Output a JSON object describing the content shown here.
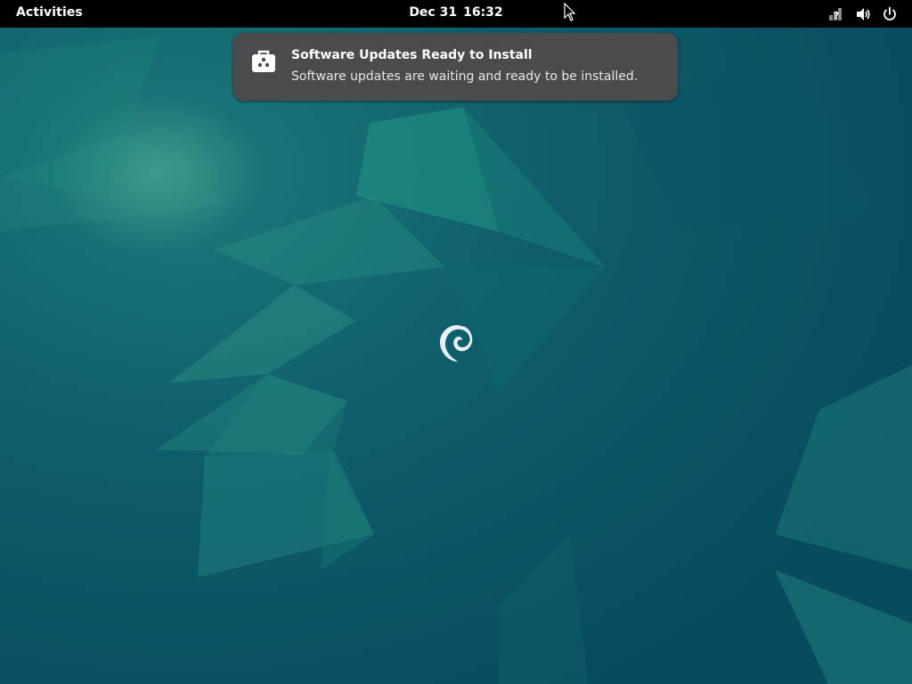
{
  "topbar": {
    "activities_label": "Activities",
    "date": "Dec 31",
    "time": "16:32",
    "tray_icons": [
      "network-unknown-icon",
      "volume-icon",
      "power-icon"
    ]
  },
  "notification": {
    "icon": "software-update-icon",
    "title": "Software Updates Ready to Install",
    "body": "Software updates are waiting and ready to be installed."
  },
  "desktop": {
    "logo": "debian-swirl-logo"
  },
  "colors": {
    "topbar_bg": "#000000",
    "notification_bg": "#4a4b4d",
    "wallpaper_base": "#0b4f63",
    "wallpaper_accent": "#1a8a7a"
  }
}
